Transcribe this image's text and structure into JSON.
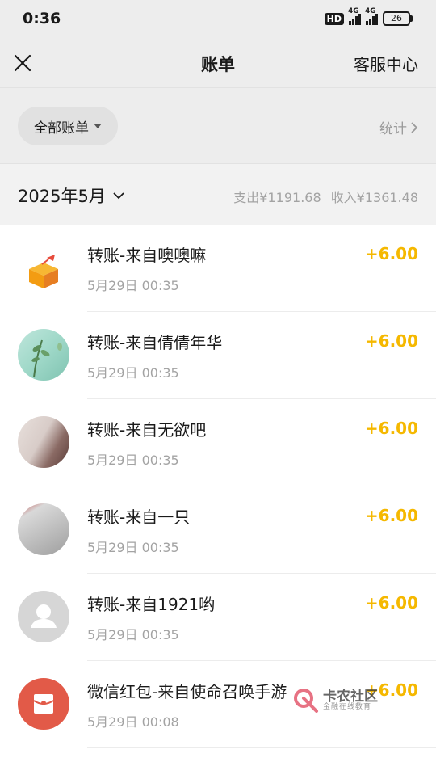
{
  "status_bar": {
    "time": "0:36",
    "hd_label": "HD",
    "network_1": "4G",
    "network_2": "4G",
    "battery": "26"
  },
  "nav": {
    "title": "账单",
    "service_label": "客服中心"
  },
  "filter": {
    "chip_label": "全部账单",
    "stats_label": "统计"
  },
  "month_bar": {
    "month_label": "2025年5月",
    "expense_label": "支出",
    "expense_value": "¥1191.68",
    "income_label": "收入",
    "income_value": "¥1361.48"
  },
  "transactions": [
    {
      "title": "转账-来自噢噢嘛",
      "time": "5月29日 00:35",
      "amount": "+6.00",
      "avatar": "gift-box-avatar"
    },
    {
      "title": "转账-来自倩倩年华",
      "time": "5月29日 00:35",
      "amount": "+6.00",
      "avatar": "plant-photo-avatar"
    },
    {
      "title": "转账-来自无欲吧",
      "time": "5月29日 00:35",
      "amount": "+6.00",
      "avatar": "blurred-photo-avatar"
    },
    {
      "title": "转账-来自一只",
      "time": "5月29日 00:35",
      "amount": "+6.00",
      "avatar": "gray-photo-avatar"
    },
    {
      "title": "转账-来自1921哟",
      "time": "5月29日 00:35",
      "amount": "+6.00",
      "avatar": "default-user-avatar"
    },
    {
      "title": "微信红包-来自使命召唤手游",
      "time": "5月29日 00:08",
      "amount": "+6.00",
      "avatar": "red-packet-avatar"
    }
  ],
  "watermark": {
    "main": "卡农社区",
    "sub": "金融在线教育"
  },
  "colors": {
    "amount": "#f5b800",
    "background": "#ededed",
    "red_packet": "#e25a48"
  }
}
